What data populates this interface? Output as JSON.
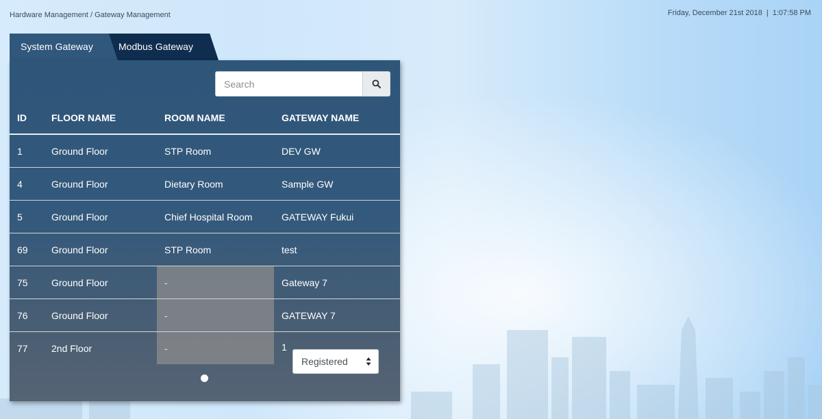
{
  "breadcrumb": "Hardware Management / Gateway Management",
  "datetime": {
    "date": "Friday, December 21st 2018",
    "separator": "|",
    "time": "1:07:58 PM"
  },
  "tabs": [
    {
      "label": "System Gateway"
    },
    {
      "label": "Modbus Gateway",
      "active": true
    }
  ],
  "search": {
    "placeholder": "Search",
    "value": "",
    "icon": "search-icon"
  },
  "table": {
    "columns": [
      "ID",
      "FLOOR NAME",
      "ROOM NAME",
      "GATEWAY NAME"
    ],
    "rows": [
      {
        "id": "1",
        "floor": "Ground Floor",
        "room": "STP Room",
        "gateway": "DEV GW"
      },
      {
        "id": "4",
        "floor": "Ground Floor",
        "room": "Dietary Room",
        "gateway": "Sample GW"
      },
      {
        "id": "5",
        "floor": "Ground Floor",
        "room": "Chief Hospital Room",
        "gateway": "GATEWAY Fukui"
      },
      {
        "id": "69",
        "floor": "Ground Floor",
        "room": "STP Room",
        "gateway": "test"
      },
      {
        "id": "75",
        "floor": "Ground Floor",
        "room": "-",
        "gateway": "Gateway 7"
      },
      {
        "id": "76",
        "floor": "Ground Floor",
        "room": "-",
        "gateway": "GATEWAY 7"
      },
      {
        "id": "77",
        "floor": "2nd Floor",
        "room": "-",
        "gateway": "1"
      }
    ]
  },
  "status_select": {
    "selected": "Registered"
  },
  "colors": {
    "panel": "#33597c",
    "active_tab": "#0f2d4f",
    "inactive_tab": "#30577c",
    "empty_cell": "#8c8c8c"
  }
}
